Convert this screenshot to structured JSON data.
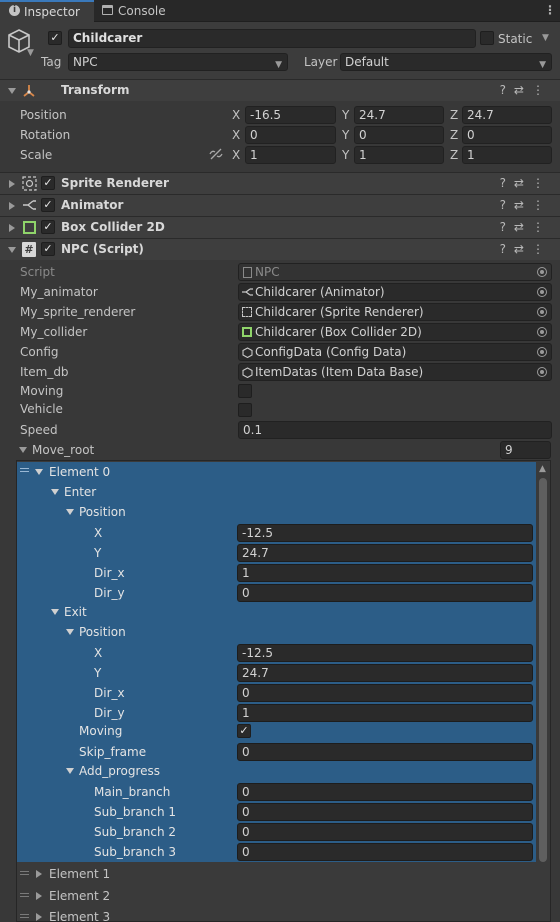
{
  "tabs": [
    {
      "label": "Inspector",
      "active": true
    },
    {
      "label": "Console",
      "active": false
    }
  ],
  "object": {
    "name": "Childcarer",
    "active": true,
    "static_label": "Static",
    "tag_label": "Tag",
    "tag_value": "NPC",
    "layer_label": "Layer",
    "layer_value": "Default"
  },
  "transform": {
    "title": "Transform",
    "rows": [
      {
        "label": "Position",
        "x": "-16.5",
        "y": "24.7",
        "z": "24.7"
      },
      {
        "label": "Rotation",
        "x": "0",
        "y": "0",
        "z": "0"
      },
      {
        "label": "Scale",
        "x": "1",
        "y": "1",
        "z": "1"
      }
    ],
    "axes": [
      "X",
      "Y",
      "Z"
    ]
  },
  "components": [
    {
      "title": "Sprite Renderer",
      "enabled": true
    },
    {
      "title": "Animator",
      "enabled": true
    },
    {
      "title": "Box Collider 2D",
      "enabled": true
    },
    {
      "title": "NPC (Script)",
      "enabled": true
    }
  ],
  "npc": {
    "script_label": "Script",
    "script_value": "NPC",
    "refs": [
      {
        "label": "My_animator",
        "value": "Childcarer (Animator)"
      },
      {
        "label": "My_sprite_renderer",
        "value": "Childcarer (Sprite Renderer)"
      },
      {
        "label": "My_collider",
        "value": "Childcarer (Box Collider 2D)"
      },
      {
        "label": "Config",
        "value": "ConfigData (Config Data)"
      },
      {
        "label": "Item_db",
        "value": "ItemDatas (Item Data Base)"
      }
    ],
    "moving_label": "Moving",
    "moving": false,
    "vehicle_label": "Vehicle",
    "vehicle": false,
    "speed_label": "Speed",
    "speed": "0.1",
    "move_root_label": "Move_root",
    "move_root_size": "9"
  },
  "element0": {
    "label": "Element 0",
    "enter_label": "Enter",
    "enter_position_label": "Position",
    "enter_fields": [
      {
        "label": "X",
        "value": "-12.5"
      },
      {
        "label": "Y",
        "value": "24.7"
      },
      {
        "label": "Dir_x",
        "value": "1"
      },
      {
        "label": "Dir_y",
        "value": "0"
      }
    ],
    "exit_label": "Exit",
    "exit_position_label": "Position",
    "exit_fields": [
      {
        "label": "X",
        "value": "-12.5"
      },
      {
        "label": "Y",
        "value": "24.7"
      },
      {
        "label": "Dir_x",
        "value": "0"
      },
      {
        "label": "Dir_y",
        "value": "1"
      }
    ],
    "moving_label": "Moving",
    "moving": true,
    "skip_frame_label": "Skip_frame",
    "skip_frame": "0",
    "add_progress_label": "Add_progress",
    "progress_fields": [
      {
        "label": "Main_branch",
        "value": "0"
      },
      {
        "label": "Sub_branch 1",
        "value": "0"
      },
      {
        "label": "Sub_branch 2",
        "value": "0"
      },
      {
        "label": "Sub_branch 3",
        "value": "0"
      }
    ]
  },
  "other_elements": [
    "Element 1",
    "Element 2",
    "Element 3"
  ]
}
